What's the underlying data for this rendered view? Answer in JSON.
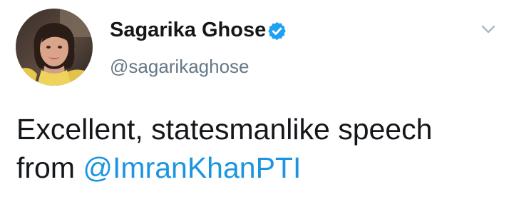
{
  "author": {
    "display_name": "Sagarika Ghose",
    "handle": "@sagarikaghose",
    "verified": true,
    "avatar": "profile-photo"
  },
  "tweet": {
    "text_line_1": "Excellent, statesmanlike speech",
    "text_line_2_prefix": "from ",
    "mention": "@ImranKhanPTI"
  },
  "icons": {
    "verified": "verified-badge-icon",
    "menu": "chevron-down-icon"
  },
  "colors": {
    "name_text": "#14171a",
    "handle_text": "#657786",
    "mention_link": "#1b95e0",
    "verified_badge": "#1da1f2",
    "chevron": "#aab8c2"
  }
}
